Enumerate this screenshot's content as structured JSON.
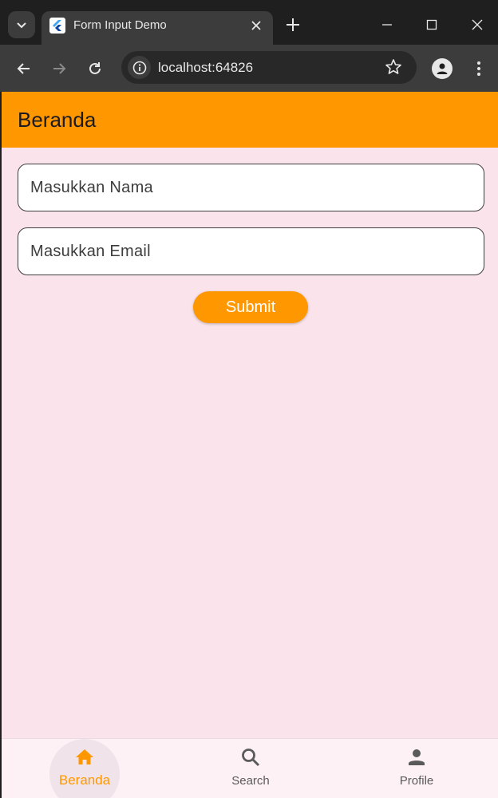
{
  "browser": {
    "tab_title": "Form Input Demo",
    "url": "localhost:64826"
  },
  "app": {
    "appbar_title": "Beranda",
    "form": {
      "name_placeholder": "Masukkan Nama",
      "email_placeholder": "Masukkan Email",
      "submit_label": "Submit"
    },
    "bottom_nav": {
      "items": [
        {
          "label": "Beranda",
          "icon": "home-icon",
          "active": true
        },
        {
          "label": "Search",
          "icon": "search-icon",
          "active": false
        },
        {
          "label": "Profile",
          "icon": "person-icon",
          "active": false
        }
      ]
    },
    "colors": {
      "accent": "#ff9800",
      "background": "#fae3ea",
      "nav_inactive": "#5a5a5a"
    }
  }
}
